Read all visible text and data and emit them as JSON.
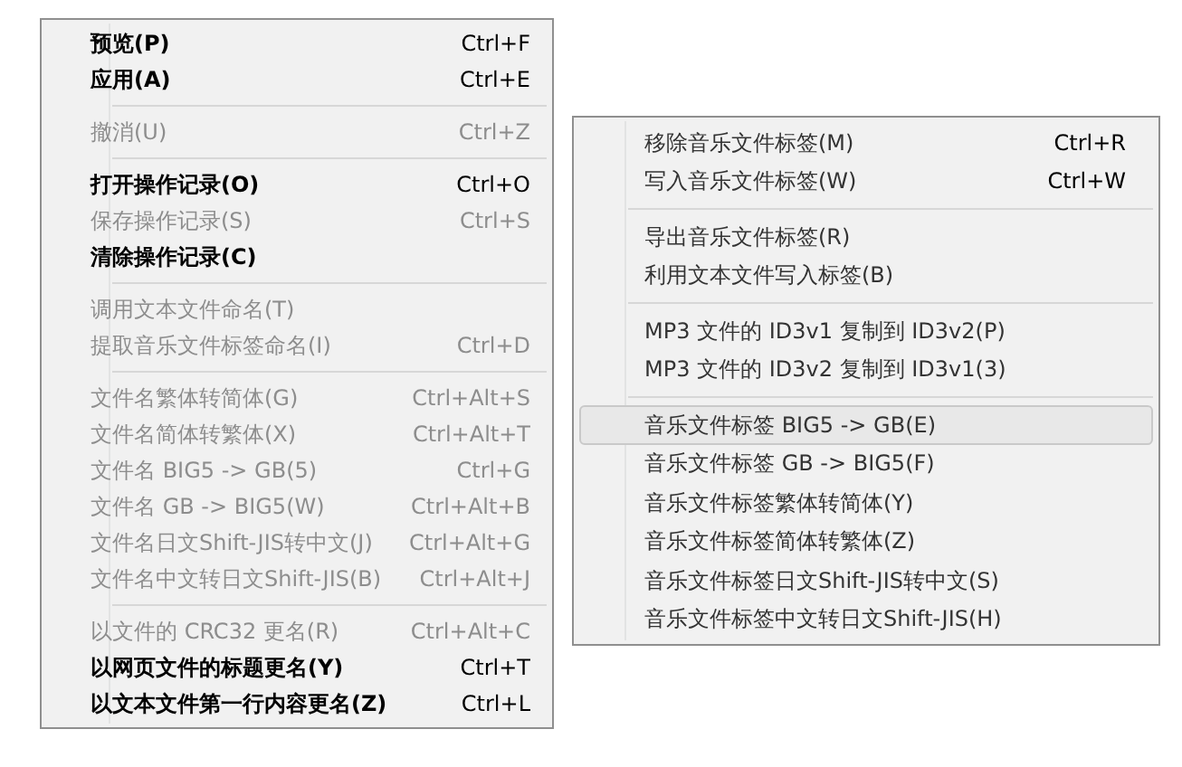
{
  "menus": [
    {
      "groups": [
        [
          {
            "label": "预览(P)",
            "shortcut": "Ctrl+F",
            "disabled": false
          },
          {
            "label": "应用(A)",
            "shortcut": "Ctrl+E",
            "disabled": false
          }
        ],
        [
          {
            "label": "撤消(U)",
            "shortcut": "Ctrl+Z",
            "disabled": true
          }
        ],
        [
          {
            "label": "打开操作记录(O)",
            "shortcut": "Ctrl+O",
            "disabled": false
          },
          {
            "label": "保存操作记录(S)",
            "shortcut": "Ctrl+S",
            "disabled": true
          },
          {
            "label": "清除操作记录(C)",
            "disabled": false
          }
        ],
        [
          {
            "label": "调用文本文件命名(T)",
            "disabled": true
          },
          {
            "label": "提取音乐文件标签命名(I)",
            "shortcut": "Ctrl+D",
            "disabled": true
          }
        ],
        [
          {
            "label": "文件名繁体转简体(G)",
            "shortcut": "Ctrl+Alt+S",
            "disabled": true
          },
          {
            "label": "文件名简体转繁体(X)",
            "shortcut": "Ctrl+Alt+T",
            "disabled": true
          },
          {
            "label": "文件名 BIG5 -> GB(5)",
            "shortcut": "Ctrl+G",
            "disabled": true
          },
          {
            "label": "文件名 GB -> BIG5(W)",
            "shortcut": "Ctrl+Alt+B",
            "disabled": true
          },
          {
            "label": "文件名日文Shift-JIS转中文(J)",
            "shortcut": "Ctrl+Alt+G",
            "disabled": true
          },
          {
            "label": "文件名中文转日文Shift-JIS(B)",
            "shortcut": "Ctrl+Alt+J",
            "disabled": true
          }
        ],
        [
          {
            "label": "以文件的 CRC32 更名(R)",
            "shortcut": "Ctrl+Alt+C",
            "disabled": true
          },
          {
            "label": "以网页文件的标题更名(Y)",
            "shortcut": "Ctrl+T",
            "disabled": false
          },
          {
            "label": "以文本文件第一行内容更名(Z)",
            "shortcut": "Ctrl+L",
            "disabled": false
          }
        ]
      ]
    },
    {
      "groups": [
        [
          {
            "label": "移除音乐文件标签(M)",
            "shortcut": "Ctrl+R",
            "selected": false
          },
          {
            "label": "写入音乐文件标签(W)",
            "shortcut": "Ctrl+W",
            "selected": false
          }
        ],
        [
          {
            "label": "导出音乐文件标签(R)",
            "selected": false
          },
          {
            "label": "利用文本文件写入标签(B)",
            "selected": false
          }
        ],
        [
          {
            "label": "MP3 文件的 ID3v1 复制到 ID3v2(P)",
            "selected": false
          },
          {
            "label": "MP3 文件的 ID3v2 复制到 ID3v1(3)",
            "selected": false
          }
        ],
        [
          {
            "label": "音乐文件标签 BIG5 -> GB(E)",
            "selected": true
          },
          {
            "label": "音乐文件标签 GB -> BIG5(F)",
            "selected": false
          },
          {
            "label": "音乐文件标签繁体转简体(Y)",
            "selected": false
          },
          {
            "label": "音乐文件标签简体转繁体(Z)",
            "selected": false
          },
          {
            "label": "音乐文件标签日文Shift-JIS转中文(S)",
            "selected": false
          },
          {
            "label": "音乐文件标签中文转日文Shift-JIS(H)",
            "selected": false
          }
        ]
      ]
    }
  ]
}
